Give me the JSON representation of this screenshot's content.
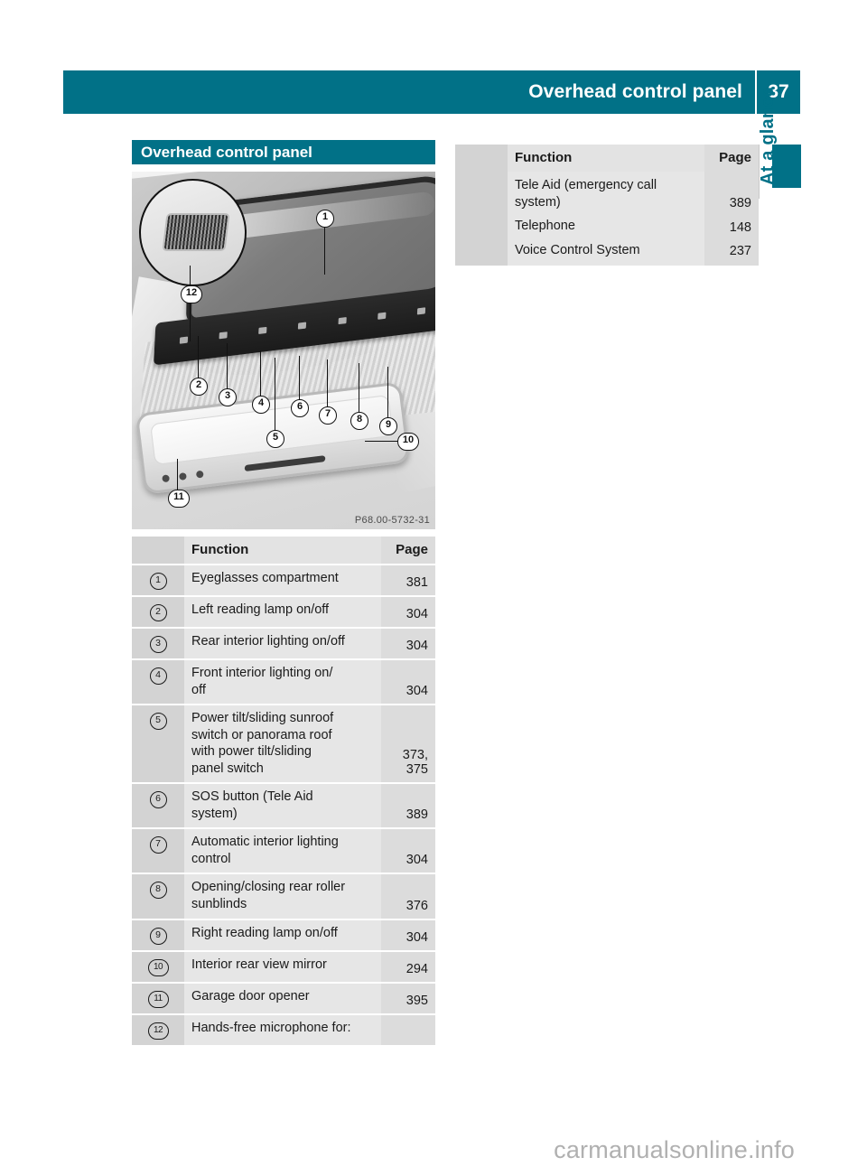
{
  "header": {
    "title": "Overhead control panel",
    "page_number": "37",
    "accent_color": "#017187"
  },
  "side_tab": {
    "label": "At a glance"
  },
  "left_column": {
    "section_title": "Overhead control panel",
    "figure": {
      "caption": "P68.00-5732-31",
      "callout_marker": "12",
      "markers": [
        "1",
        "2",
        "3",
        "4",
        "5",
        "6",
        "7",
        "8",
        "9",
        "10",
        "11",
        "12"
      ]
    },
    "table": {
      "columns": [
        "",
        "Function",
        "Page"
      ],
      "rows": [
        {
          "marker": "1",
          "function": "Eyeglasses compartment",
          "page": "381"
        },
        {
          "marker": "2",
          "function": "Left reading lamp on/off",
          "page": "304"
        },
        {
          "marker": "3",
          "function": "Rear interior lighting on/off",
          "page": "304"
        },
        {
          "marker": "4",
          "function": "Front interior lighting on/\noff",
          "page": "304"
        },
        {
          "marker": "5",
          "function": "Power tilt/sliding sunroof\nswitch or panorama roof\nwith power tilt/sliding\npanel switch",
          "page": "373,\n375"
        },
        {
          "marker": "6",
          "function": "SOS button (Tele Aid\nsystem)",
          "page": "389"
        },
        {
          "marker": "7",
          "function": "Automatic interior lighting\ncontrol",
          "page": "304"
        },
        {
          "marker": "8",
          "function": "Opening/closing rear roller\nsunblinds",
          "page": "376"
        },
        {
          "marker": "9",
          "function": "Right reading lamp on/off",
          "page": "304"
        },
        {
          "marker": "10",
          "function": "Interior rear view mirror",
          "page": "294"
        },
        {
          "marker": "11",
          "function": "Garage door opener",
          "page": "395"
        },
        {
          "marker": "12",
          "function": "Hands-free microphone for:",
          "page": ""
        }
      ]
    }
  },
  "right_column": {
    "table": {
      "columns": [
        "",
        "Function",
        "Page"
      ],
      "rows": [
        {
          "marker": "",
          "function": "Tele Aid (emergency call\nsystem)",
          "page": "389"
        },
        {
          "marker": "",
          "function": "Telephone",
          "page": "148"
        },
        {
          "marker": "",
          "function": "Voice Control System",
          "page": "237"
        }
      ]
    }
  },
  "watermark": {
    "text": "carmanualsonline.info"
  }
}
